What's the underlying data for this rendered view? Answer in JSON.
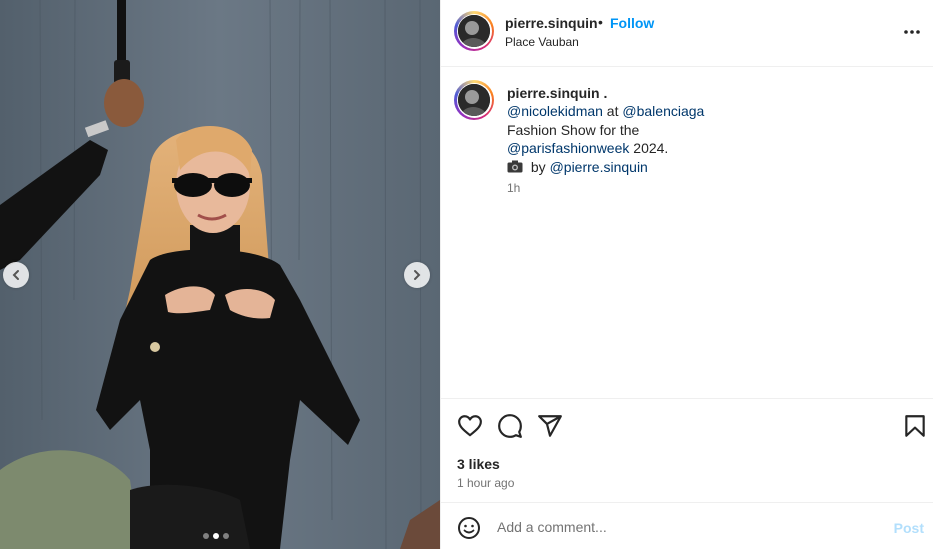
{
  "post": {
    "username": "pierre.sinquin",
    "follow_label": "Follow",
    "separator": "•",
    "location": "Place Vauban",
    "more_icon": "more-horizontal-icon"
  },
  "caption": {
    "username": "pierre.sinquin .",
    "line1_mention_a": "@nicolekidman",
    "line1_at": " at ",
    "line1_mention_b": "@balenciaga",
    "line2": "Fashion Show for the",
    "line3_mention": "@parisfashionweek",
    "line3_text": " 2024.",
    "line4_by": " by ",
    "line4_mention": "@pierre.sinquin",
    "time": "1h"
  },
  "media": {
    "carousel_count": 3,
    "active_index": 1
  },
  "actions": {
    "likes": "3 likes",
    "time_ago": "1 hour ago"
  },
  "comment": {
    "placeholder": "Add a comment...",
    "post_label": "Post"
  },
  "colors": {
    "link": "#0095f6",
    "mention": "#00376b",
    "muted": "#737373",
    "post_disabled": "#b2dffc"
  }
}
